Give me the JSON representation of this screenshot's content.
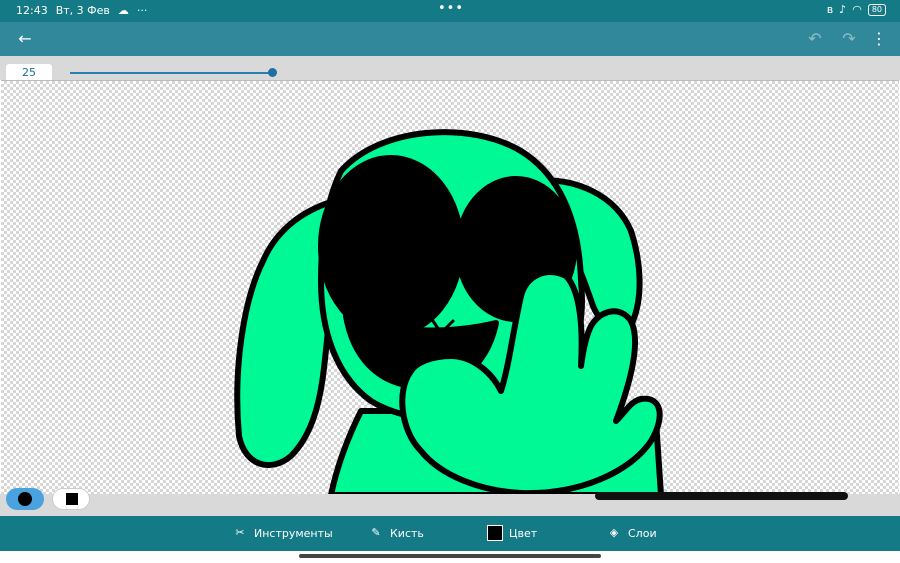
{
  "status_bar": {
    "time": "12:43",
    "date": "Вт, 3 Фев",
    "cloud_icon": "cloud-icon",
    "overflow_dots": "···",
    "center_dots": "•••",
    "bluetooth_icon": "bluetooth-icon",
    "mute_icon": "bell-off-icon",
    "wifi_icon": "wifi-icon",
    "battery": "80"
  },
  "app_bar": {
    "back_icon": "arrow-left-icon",
    "undo_icon": "undo-icon",
    "redo_icon": "redo-icon",
    "more_icon": "more-vertical-icon"
  },
  "brush_size": {
    "value": "25",
    "slider_level_percent": 100
  },
  "canvas": {
    "background": "transparent-checkerboard",
    "fill_color": "#00f995",
    "outline_color": "#000000"
  },
  "shape_modes": {
    "round": {
      "icon": "circle-icon",
      "selected": true
    },
    "square": {
      "icon": "square-icon",
      "selected": false
    }
  },
  "bottom_nav": {
    "tools": {
      "label": "Инструменты",
      "icon": "tools-icon"
    },
    "brush": {
      "label": "Кисть",
      "icon": "brush-icon"
    },
    "color": {
      "label": "Цвет",
      "icon": "color-swatch-icon",
      "value": "#000000"
    },
    "layers": {
      "label": "Слои",
      "icon": "layers-icon"
    }
  },
  "colors": {
    "status_bar": "#137a86",
    "app_bar": "#30889a",
    "accent": "#4aa3df"
  }
}
